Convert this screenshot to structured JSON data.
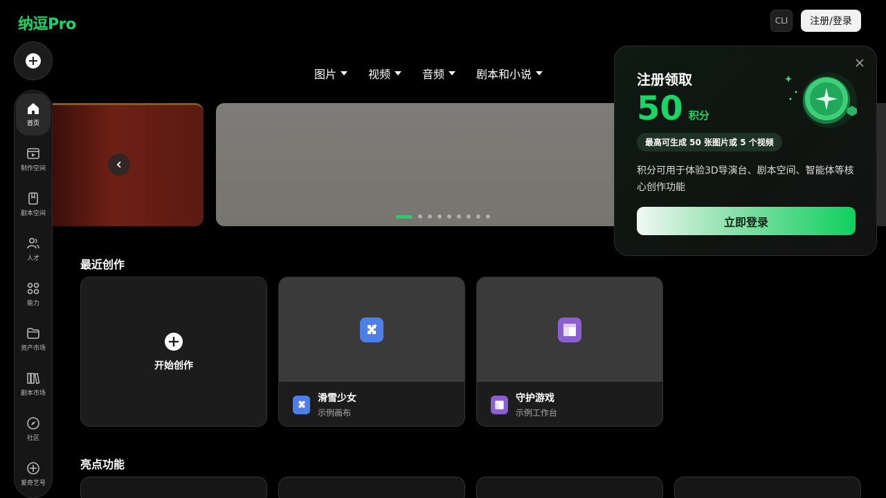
{
  "brand": {
    "logo": "纳逗Pro",
    "accent": "#1bd566"
  },
  "header": {
    "cli_label": "CLI",
    "login_label": "注册/登录"
  },
  "sidebar": {
    "items": [
      {
        "label": "首页",
        "icon": "home-icon",
        "active": true
      },
      {
        "label": "制作空间",
        "icon": "workspace-icon"
      },
      {
        "label": "剧本空间",
        "icon": "script-icon"
      },
      {
        "label": "人才",
        "icon": "people-icon"
      },
      {
        "label": "能力",
        "icon": "grid-icon"
      },
      {
        "label": "资产市场",
        "icon": "folder-icon"
      },
      {
        "label": "剧本市场",
        "icon": "books-icon"
      },
      {
        "label": "社区",
        "icon": "compass-icon"
      },
      {
        "label": "爱奇艺号",
        "icon": "iqiyi-icon"
      }
    ]
  },
  "nav": {
    "items": [
      "图片",
      "视频",
      "音频",
      "剧本和小说"
    ]
  },
  "banner": {
    "dot_count": 9,
    "active_dot": 0
  },
  "recent": {
    "title": "最近创作",
    "new_label": "开始创作",
    "cards": [
      {
        "title": "滑雪少女",
        "subtitle": "示例画布",
        "icon": "canvas-icon",
        "color": "#4d7fe8"
      },
      {
        "title": "守护游戏",
        "subtitle": "示例工作台",
        "icon": "workbench-icon",
        "color": "#8b5fd0"
      }
    ]
  },
  "features": {
    "title": "亮点功能"
  },
  "popup": {
    "title": "注册领取",
    "points": "50",
    "unit": "积分",
    "pill": "最高可生成 50 张图片或 5 个视频",
    "desc": "积分可用于体验3D导演台、剧本空间、智能体等核心创作功能",
    "cta": "立即登录"
  }
}
